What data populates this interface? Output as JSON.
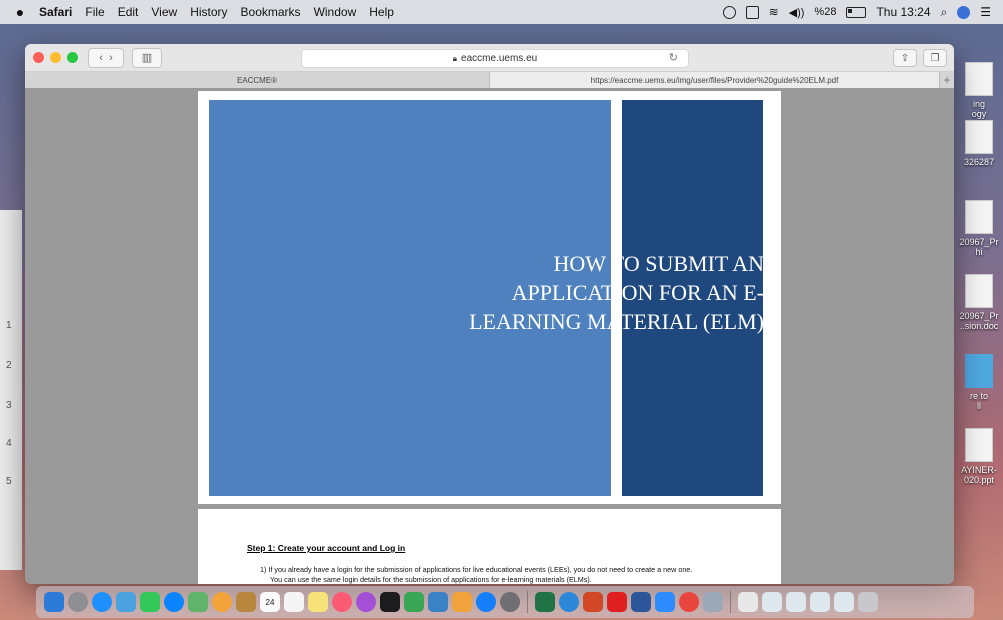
{
  "menubar": {
    "app_name": "Safari",
    "menus": [
      "File",
      "Edit",
      "View",
      "History",
      "Bookmarks",
      "Window",
      "Help"
    ],
    "battery_percent": "%28",
    "clock": "Thu 13:24"
  },
  "browser": {
    "url": "eaccme.uems.eu",
    "tabs": [
      {
        "label": "EACCME®"
      },
      {
        "label": "https://eaccme.uems.eu/img/user/files/Provider%20guide%20ELM.pdf"
      }
    ],
    "new_tab_label": "+"
  },
  "document": {
    "title_lines": [
      "HOW TO SUBMIT AN",
      "APPLICATION FOR AN E-",
      "LEARNING MATERIAL (ELM)"
    ],
    "step_heading": "Step 1: Create your account and Log in",
    "para_line1": "1)   If you already have a login for the submission of applications for live educational events (LEEs), you do not need to create a new one.",
    "para_line2": "You can use the same login details for the submission of applications for e-learning materials (ELMs)."
  },
  "desktop": {
    "files": [
      {
        "label": "ing\nogy"
      },
      {
        "label": "326287\n"
      },
      {
        "label": "20967_Pr\nhi"
      },
      {
        "label": "20967_Pr\n..sion.doc"
      },
      {
        "label": "re to\nll"
      },
      {
        "label": "AYINER-\n020.ppt"
      }
    ],
    "left_numbers": [
      "1",
      "2",
      "3",
      "4",
      "5"
    ]
  },
  "dock": {
    "calendar_day": "24"
  }
}
